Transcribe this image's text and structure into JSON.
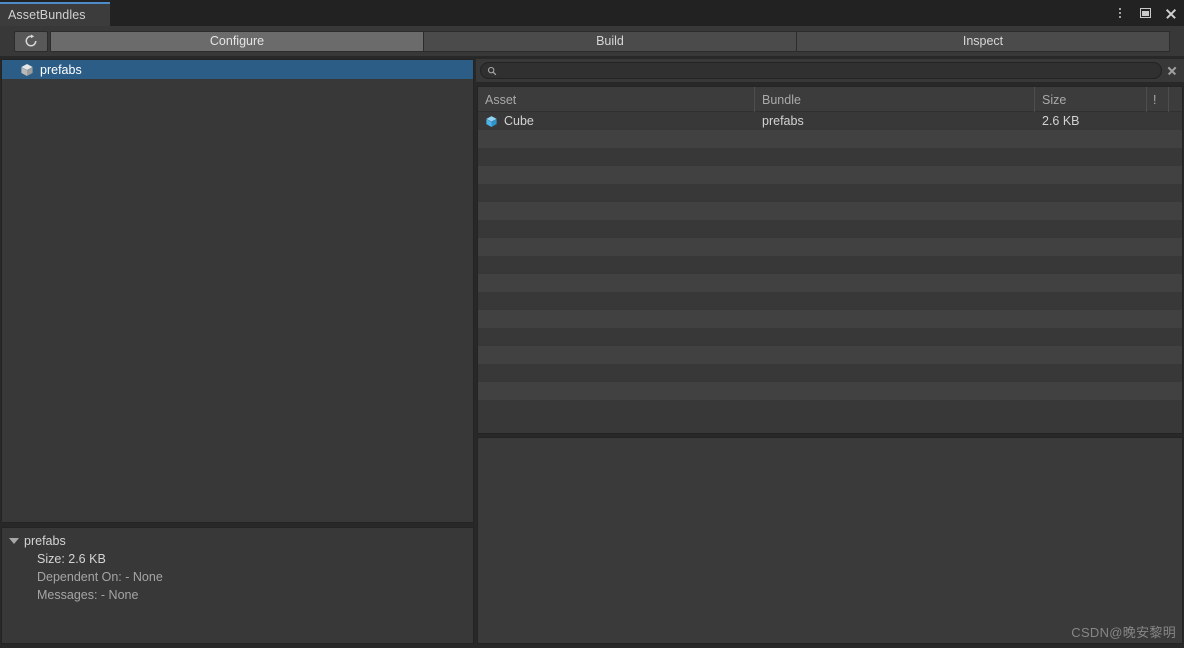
{
  "window": {
    "tab_title": "AssetBundles",
    "controls": {
      "menu_label": "⋮",
      "maximize_label": "□",
      "close_label": "✕"
    },
    "accent_color": "#4d8bc9"
  },
  "toolbar": {
    "refresh_label": "⟳",
    "refresh_name": "refresh-icon",
    "tabs": [
      {
        "label": "Configure",
        "active": true
      },
      {
        "label": "Build",
        "active": false
      },
      {
        "label": "Inspect",
        "active": false
      }
    ]
  },
  "bundle_tree": {
    "items": [
      {
        "label": "prefabs",
        "icon": "package-icon",
        "selected": true
      }
    ],
    "selection_color": "#2c5d87"
  },
  "search": {
    "value": "",
    "placeholder": "",
    "icon": "search-icon",
    "clear_icon": "close-icon"
  },
  "asset_table": {
    "columns": [
      "Asset",
      "Bundle",
      "Size",
      "!"
    ],
    "rows": [
      {
        "asset": "Cube",
        "bundle": "prefabs",
        "size": "2.6 KB",
        "warn": "",
        "icon": "prefab-cube-icon"
      }
    ],
    "empty_row_count": 16
  },
  "bundle_detail": {
    "title": "prefabs",
    "expanded": true,
    "lines": [
      {
        "text": "Size: 2.6 KB",
        "emphasis": "bright"
      },
      {
        "text": "Dependent On: - None",
        "emphasis": "dim"
      },
      {
        "text": "Messages: - None",
        "emphasis": "dim"
      }
    ]
  },
  "watermark": {
    "text": "CSDN@晚安黎明"
  }
}
